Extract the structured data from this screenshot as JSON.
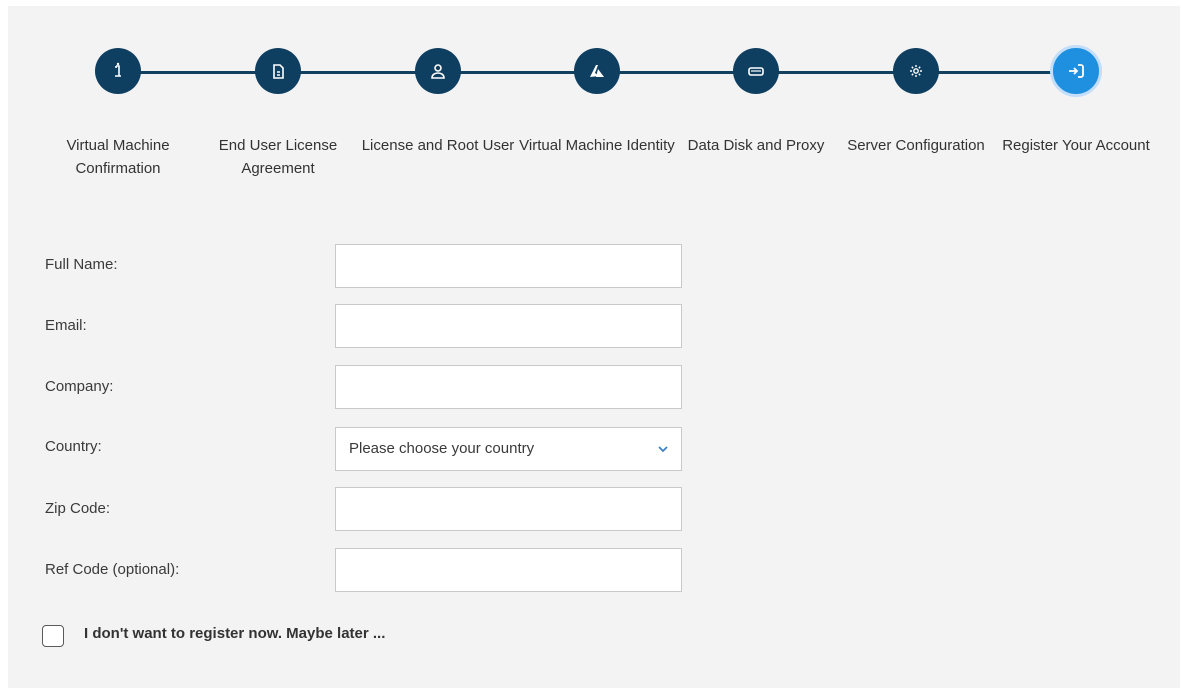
{
  "stepper": {
    "steps": [
      {
        "label": "Virtual Machine Confirmation",
        "icon": "info-icon",
        "active": false
      },
      {
        "label": "End User License Agreement",
        "icon": "document-icon",
        "active": false
      },
      {
        "label": "License and Root User",
        "icon": "user-icon",
        "active": false
      },
      {
        "label": "Virtual Machine Identity",
        "icon": "azure-icon",
        "active": false
      },
      {
        "label": "Data Disk and Proxy",
        "icon": "disk-icon",
        "active": false
      },
      {
        "label": "Server Configuration",
        "icon": "gear-icon",
        "active": false
      },
      {
        "label": "Register Your Account",
        "icon": "sign-in-icon",
        "active": true
      }
    ],
    "colors": {
      "completed": "#0f3f60",
      "active": "#1f8fe0",
      "line": "#12405f"
    }
  },
  "form": {
    "full_name": {
      "label": "Full Name:",
      "value": ""
    },
    "email": {
      "label": "Email:",
      "value": ""
    },
    "company": {
      "label": "Company:",
      "value": ""
    },
    "country": {
      "label": "Country:",
      "selected": "Please choose your country"
    },
    "zip_code": {
      "label": "Zip Code:",
      "value": ""
    },
    "ref_code": {
      "label": "Ref Code (optional):",
      "value": ""
    }
  },
  "skip_registration": {
    "label": "I don't want to register now. Maybe later ...",
    "checked": false
  }
}
